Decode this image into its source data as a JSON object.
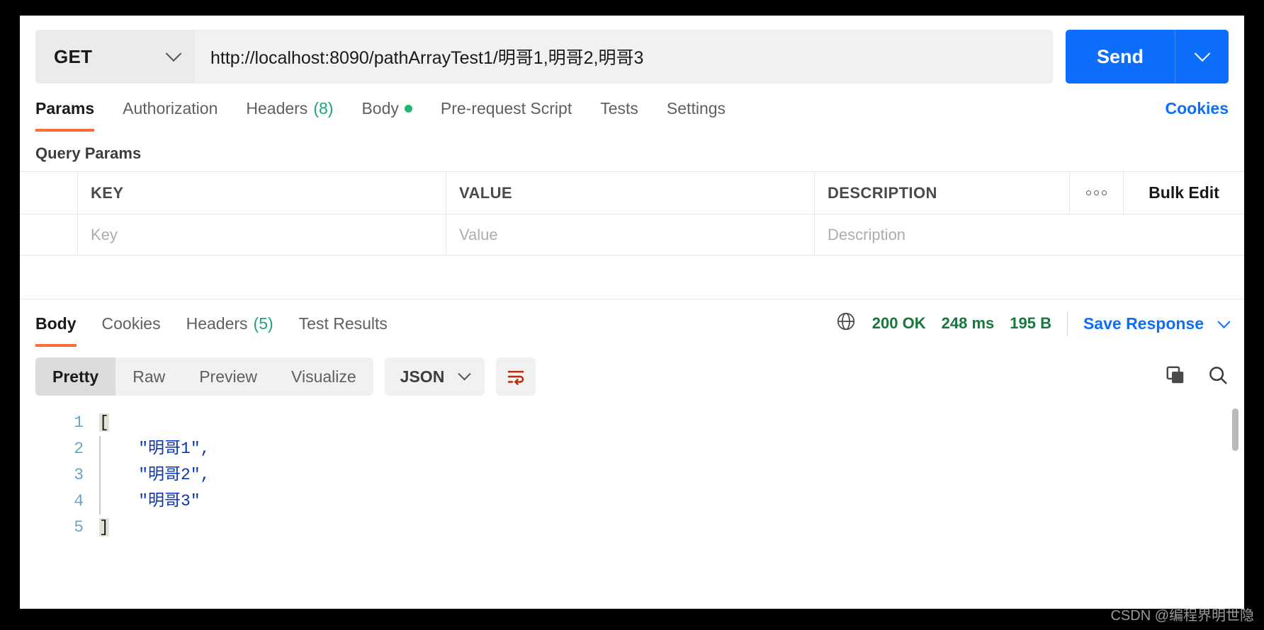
{
  "request": {
    "method": "GET",
    "url": "http://localhost:8090/pathArrayTest1/明哥1,明哥2,明哥3",
    "send_label": "Send",
    "tabs": [
      {
        "label": "Params",
        "active": true
      },
      {
        "label": "Authorization",
        "active": false
      },
      {
        "label": "Headers",
        "count": "(8)",
        "active": false
      },
      {
        "label": "Body",
        "dot": true,
        "active": false
      },
      {
        "label": "Pre-request Script",
        "active": false
      },
      {
        "label": "Tests",
        "active": false
      },
      {
        "label": "Settings",
        "active": false
      }
    ],
    "cookies_link": "Cookies"
  },
  "query_params": {
    "title": "Query Params",
    "columns": [
      "KEY",
      "VALUE",
      "DESCRIPTION"
    ],
    "bulk_edit_label": "Bulk Edit",
    "placeholders": {
      "key": "Key",
      "value": "Value",
      "description": "Description"
    }
  },
  "response": {
    "tabs": [
      {
        "label": "Body",
        "active": true
      },
      {
        "label": "Cookies",
        "active": false
      },
      {
        "label": "Headers",
        "count": "(5)",
        "active": false
      },
      {
        "label": "Test Results",
        "active": false
      }
    ],
    "status_code": "200 OK",
    "time": "248 ms",
    "size": "195 B",
    "save_response_label": "Save Response",
    "viewer": {
      "modes": [
        {
          "label": "Pretty",
          "active": true
        },
        {
          "label": "Raw",
          "active": false
        },
        {
          "label": "Preview",
          "active": false
        },
        {
          "label": "Visualize",
          "active": false
        }
      ],
      "format": "JSON"
    },
    "body_lines": [
      {
        "num": "1",
        "kind": "bracket",
        "text": "["
      },
      {
        "num": "2",
        "kind": "string",
        "text": "\"明哥1\","
      },
      {
        "num": "3",
        "kind": "string",
        "text": "\"明哥2\","
      },
      {
        "num": "4",
        "kind": "string",
        "text": "\"明哥3\""
      },
      {
        "num": "5",
        "kind": "bracket",
        "text": "]"
      }
    ]
  },
  "watermark": "CSDN @编程界明世隐",
  "colors": {
    "accent_orange": "#ff6c37",
    "primary_blue": "#0d6efd",
    "status_green": "#17773d",
    "string_blue": "#0b36b3"
  }
}
